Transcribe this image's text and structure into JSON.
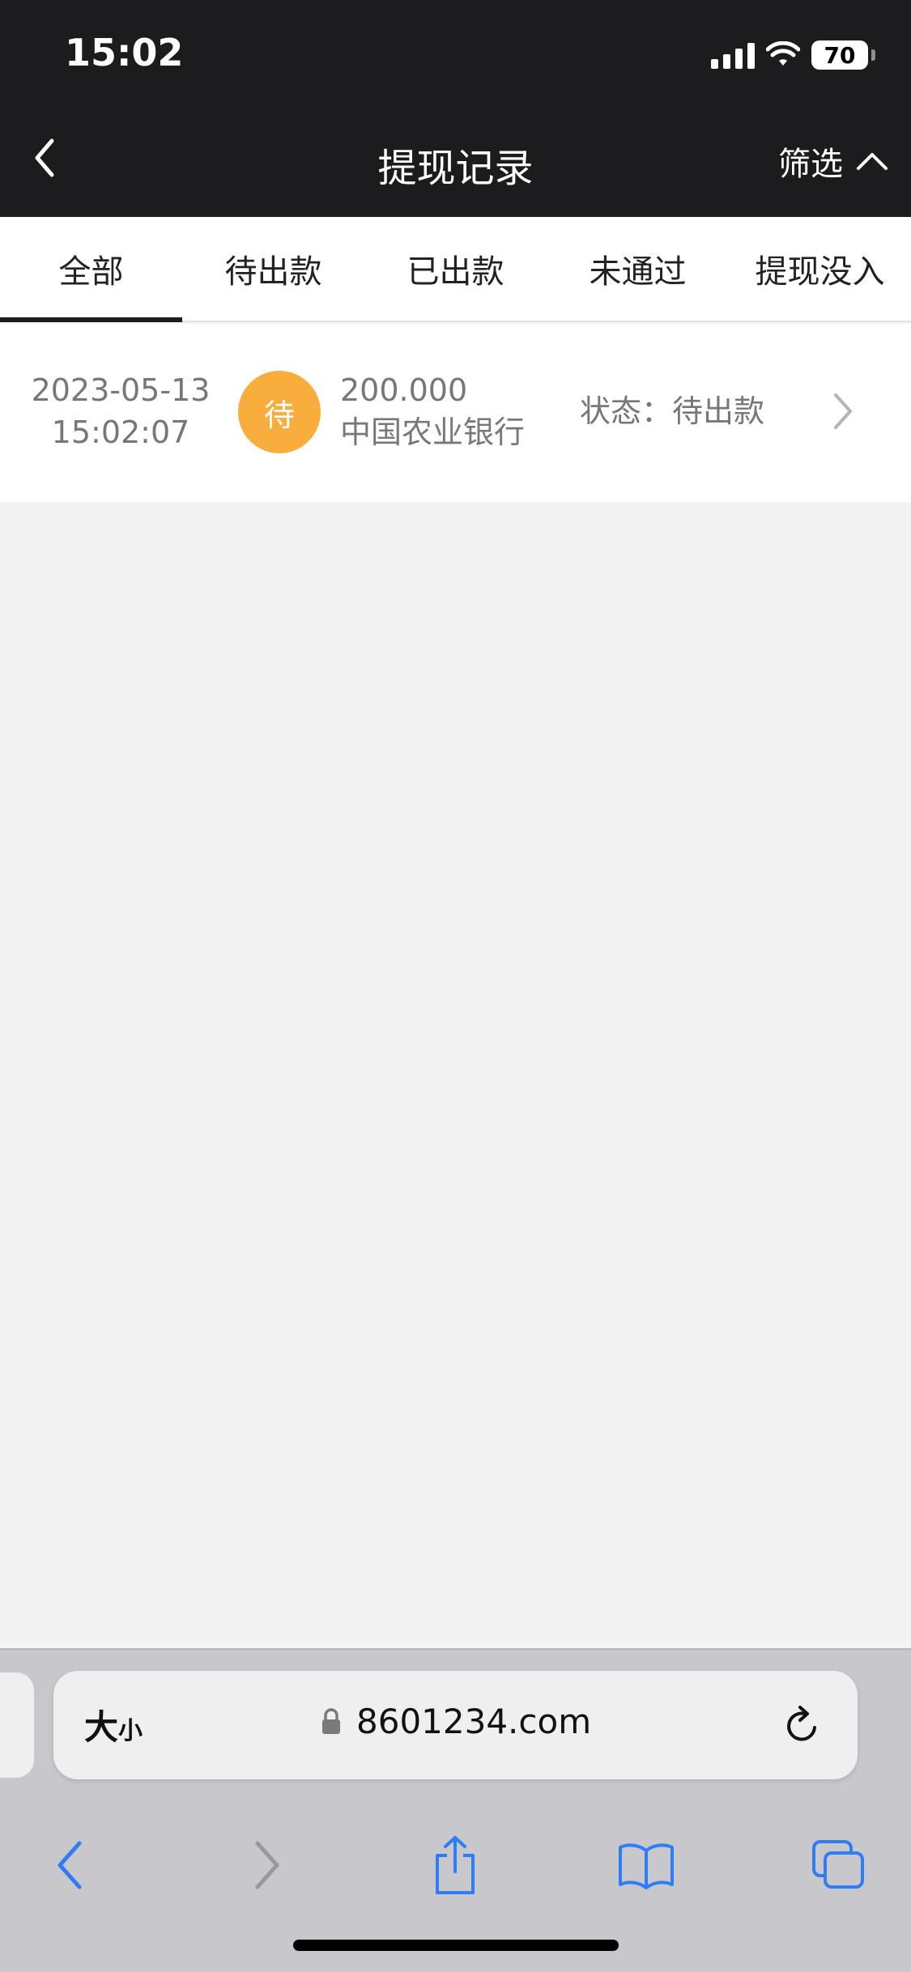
{
  "status_bar": {
    "time": "15:02",
    "battery": "70"
  },
  "nav": {
    "title": "提现记录",
    "filter_label": "筛选"
  },
  "tabs": [
    {
      "label": "全部",
      "active": true
    },
    {
      "label": "待出款",
      "active": false
    },
    {
      "label": "已出款",
      "active": false
    },
    {
      "label": "未通过",
      "active": false
    },
    {
      "label": "提现没入",
      "active": false
    }
  ],
  "records": [
    {
      "date": "2023-05-13",
      "time": "15:02:07",
      "badge": "待",
      "amount": "200.000",
      "bank": "中国农业银行",
      "status": "状态：待出款"
    }
  ],
  "browser": {
    "text_size_big": "大",
    "text_size_small": "小",
    "url": "8601234.com"
  },
  "colors": {
    "header_bg": "#1c1c1e",
    "badge_pending": "#f8ad3d",
    "page_bg": "#f3f3f3",
    "browser_accent": "#2f7df6"
  },
  "icons": [
    "back-icon",
    "chevron-up-icon",
    "chevron-right-icon",
    "lock-icon",
    "reload-icon",
    "share-icon",
    "bookmarks-icon",
    "tabs-icon"
  ]
}
